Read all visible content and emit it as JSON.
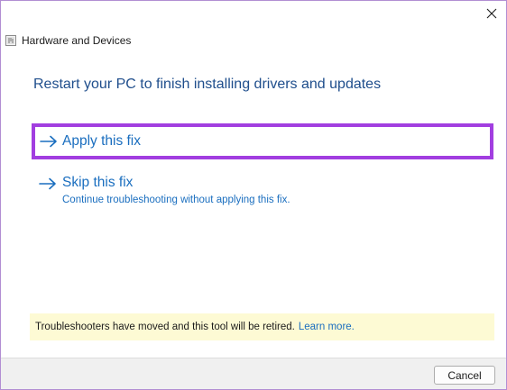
{
  "window": {
    "title": "Hardware and Devices",
    "app_icon": "troubleshooter-icon",
    "close_icon": "close-icon"
  },
  "main": {
    "heading": "Restart your PC to finish installing drivers and updates",
    "options": [
      {
        "label": "Apply this fix",
        "icon": "arrow-right-icon",
        "highlighted": true,
        "highlight_color": "#a23ee0"
      },
      {
        "label": "Skip this fix",
        "icon": "arrow-right-icon",
        "description": "Continue troubleshooting without applying this fix."
      }
    ]
  },
  "notice": {
    "text": "Troubleshooters have moved and this tool will be retired.",
    "link": "Learn more.",
    "background": "#fdfad4"
  },
  "footer": {
    "cancel_label": "Cancel"
  },
  "colors": {
    "link_blue": "#1a6ebf",
    "heading_blue": "#1f4e8c",
    "window_border": "#b28ed3"
  }
}
